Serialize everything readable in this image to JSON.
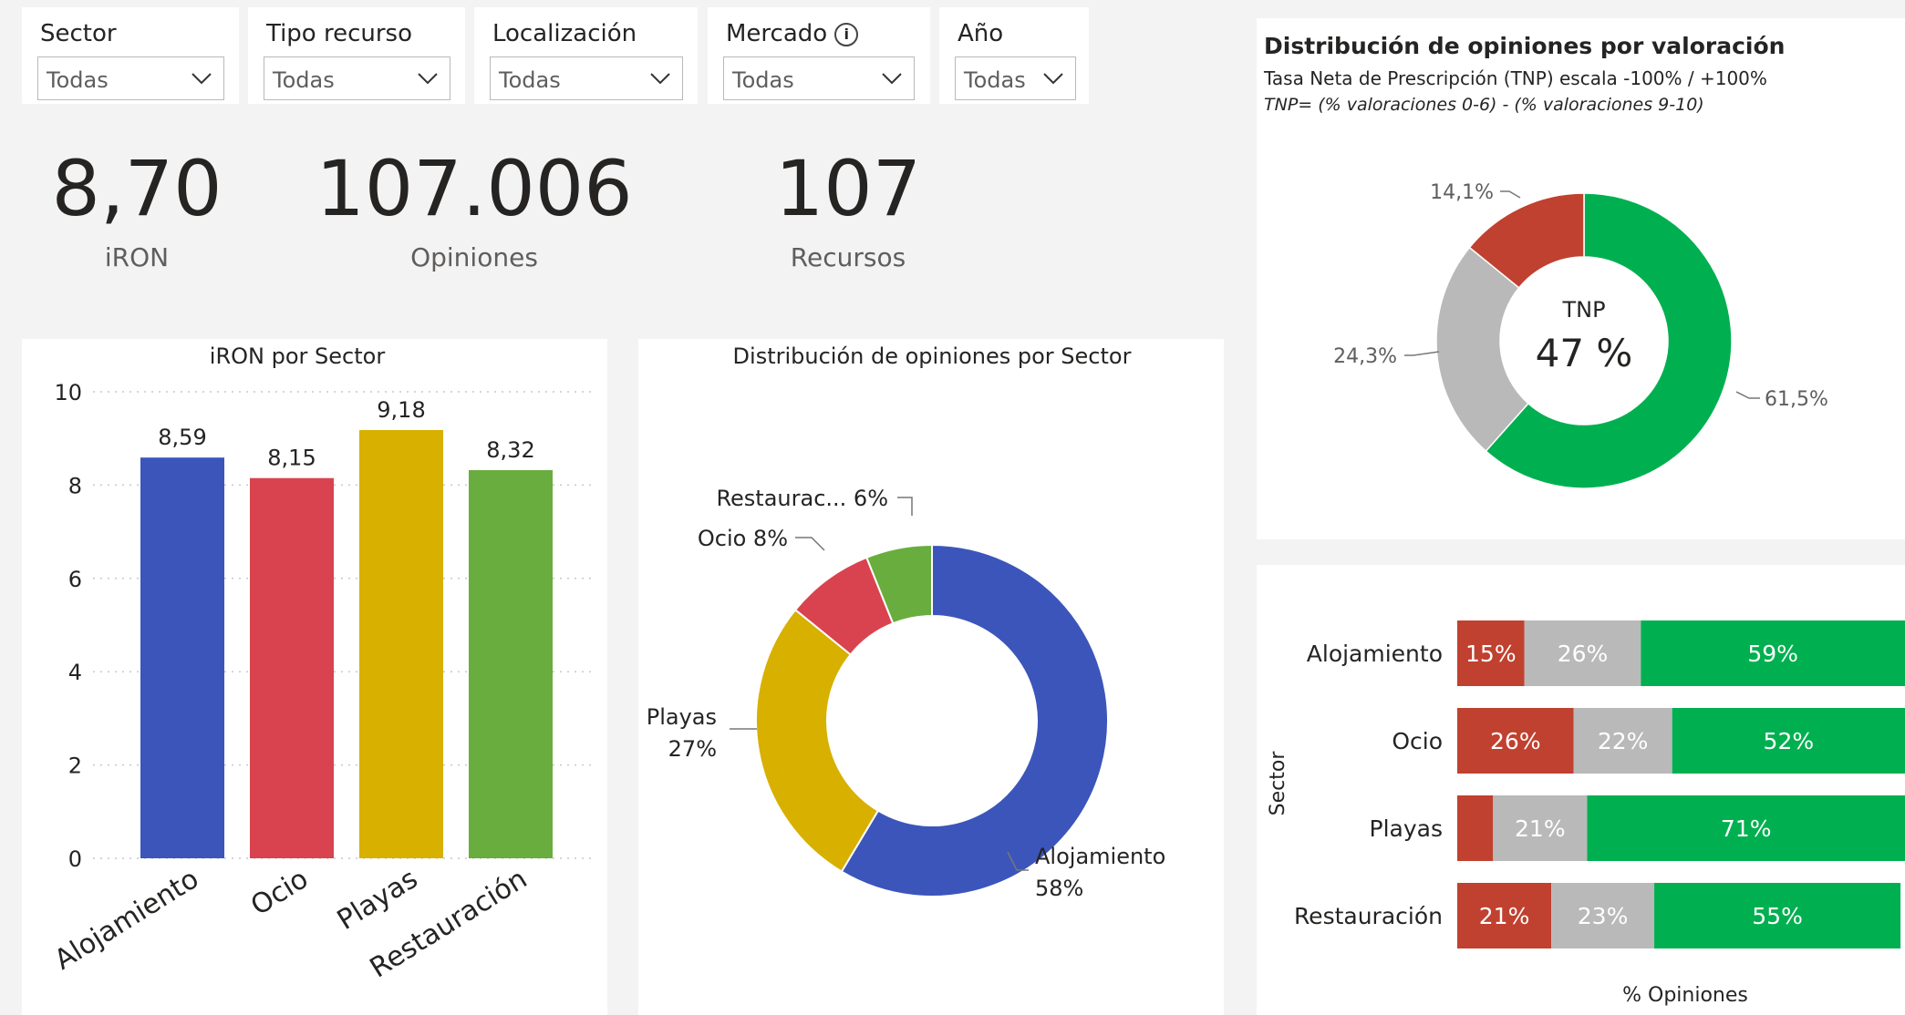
{
  "slicers": [
    {
      "title": "Sector",
      "value": "Todas"
    },
    {
      "title": "Tipo recurso",
      "value": "Todas"
    },
    {
      "title": "Localización",
      "value": "Todas"
    },
    {
      "title": "Mercado",
      "value": "Todas",
      "info_icon": "info-icon"
    },
    {
      "title": "Año",
      "value": "Todas"
    }
  ],
  "kpis": [
    {
      "value": "8,70",
      "label": "iRON"
    },
    {
      "value": "107.006",
      "label": "Opiniones"
    },
    {
      "value": "107",
      "label": "Recursos"
    }
  ],
  "colors": {
    "alojamiento": "#3c55bb",
    "ocio": "#d9434f",
    "playas": "#d7b000",
    "restauracion": "#68ad3e",
    "detractor": "#c0412f",
    "neutral": "#b9b9b9",
    "promotor": "#00b050"
  },
  "chart_data": [
    {
      "type": "bar",
      "title": "iRON por Sector",
      "categories": [
        "Alojamiento",
        "Ocio",
        "Playas",
        "Restauración"
      ],
      "values": [
        8.59,
        8.15,
        9.18,
        8.32
      ],
      "value_labels": [
        "8,59",
        "8,15",
        "9,18",
        "8,32"
      ],
      "ylim": [
        0,
        10
      ],
      "yticks": [
        "0",
        "2",
        "4",
        "6",
        "8",
        "10"
      ],
      "grid": true
    },
    {
      "type": "pie",
      "title": "Distribución de opiniones por Sector",
      "categories": [
        "Alojamiento",
        "Playas",
        "Ocio",
        "Restauración"
      ],
      "values": [
        58,
        27,
        8,
        6
      ],
      "labels": [
        {
          "text": "Alojamiento",
          "pct": "58%"
        },
        {
          "text": "Playas",
          "pct": "27%"
        },
        {
          "text": "Ocio 8%",
          "pct": ""
        },
        {
          "text": "Restaurac... 6%",
          "pct": ""
        }
      ]
    },
    {
      "type": "pie",
      "title": "Distribución de opiniones por valoración",
      "subtitle": "Tasa Neta de Prescripción (TNP) escala  -100% / +100%",
      "note": "TNP= (% valoraciones 0-6) - (% valoraciones 9-10)",
      "center_label": "TNP",
      "center_value": "47 %",
      "values": [
        61.5,
        24.3,
        14.1
      ],
      "value_labels": [
        "61,5%",
        "24,3%",
        "14,1%"
      ]
    },
    {
      "type": "bar",
      "orientation": "horizontal-stacked-100",
      "ylabel": "Sector",
      "xlabel": "% Opiniones",
      "categories": [
        "Alojamiento",
        "Ocio",
        "Playas",
        "Restauración"
      ],
      "series": [
        {
          "values": [
            15,
            26,
            8,
            21
          ],
          "labels": [
            "15%",
            "26%",
            "",
            "21%"
          ]
        },
        {
          "values": [
            26,
            22,
            21,
            23
          ],
          "labels": [
            "26%",
            "22%",
            "21%",
            "23%"
          ]
        },
        {
          "values": [
            59,
            52,
            71,
            55
          ],
          "labels": [
            "59%",
            "52%",
            "71%",
            "55%"
          ]
        }
      ]
    }
  ]
}
